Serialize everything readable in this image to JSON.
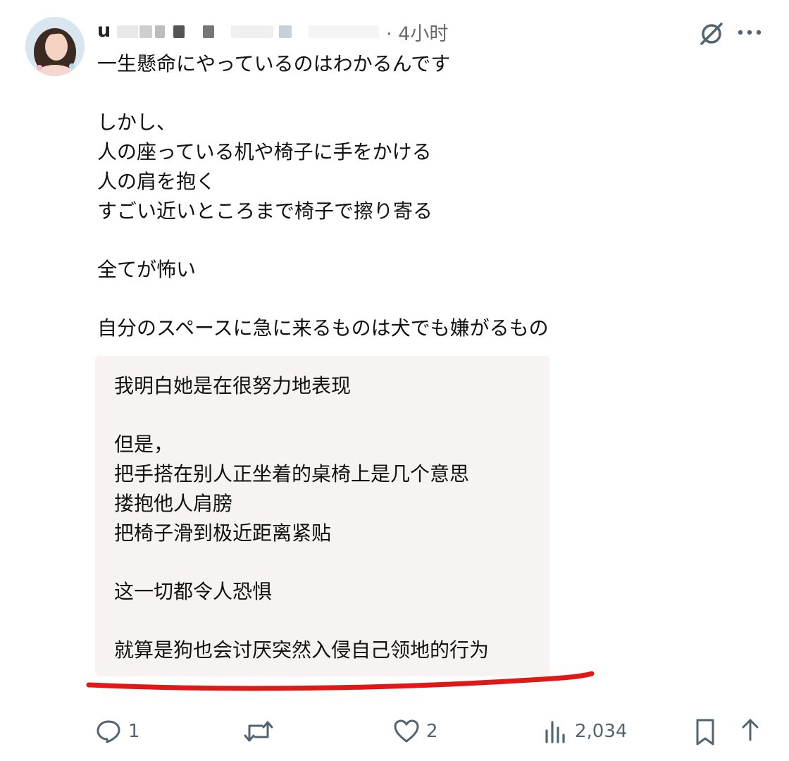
{
  "post": {
    "handle": "u",
    "time": "· 4小时",
    "text": "一生懸命にやっているのはわかるんです\n\nしかし、\n人の座っている机や椅子に手をかける\n人の肩を抱く\nすごい近いところまで椅子で擦り寄る\n\n全てが怖い\n\n自分のスペースに急に来るものは犬でも嫌がるもの"
  },
  "translation": {
    "text": "我明白她是在很努力地表现\n\n但是，\n把手搭在别人正坐着的桌椅上是几个意思\n搂抱他人肩膀\n把椅子滑到极近距离紧贴\n\n这一切都令人恐惧\n\n就算是狗也会讨厌突然入侵自己领地的行为"
  },
  "actions": {
    "replies": "1",
    "likes": "2",
    "views": "2,034"
  },
  "icons": {
    "header_right": [
      "grok-slash-icon",
      "more-icon"
    ],
    "actions": [
      "reply-icon",
      "retweet-icon",
      "like-icon",
      "views-icon",
      "bookmark-icon",
      "share-icon"
    ]
  },
  "colors": {
    "underline": "#e01818",
    "muted": "#536471",
    "translation_bg": "#f8f3f3"
  }
}
